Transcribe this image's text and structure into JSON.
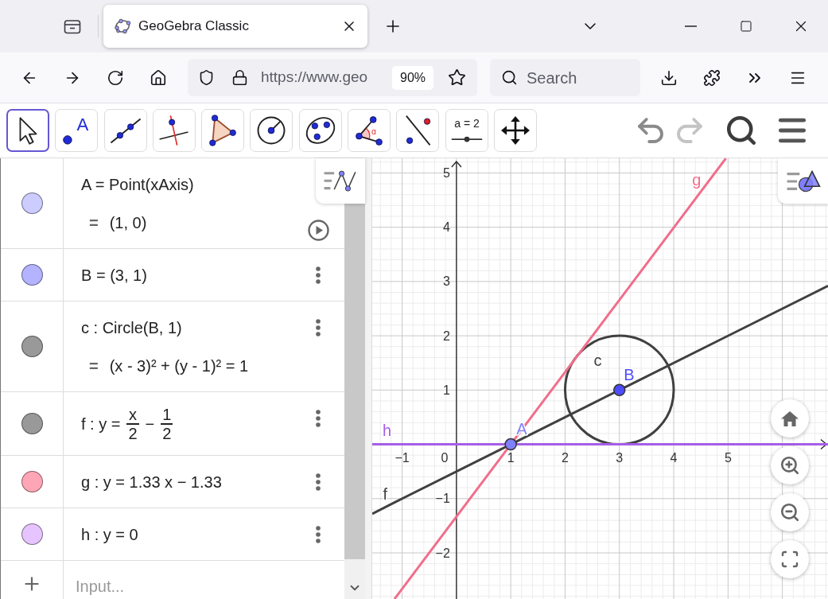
{
  "browser": {
    "tabs": [
      {
        "title": "GeoGebra Classic",
        "selected": true
      }
    ],
    "address": {
      "url": "https://www.geo",
      "zoom": "90%"
    },
    "search": {
      "placeholder": "Search"
    }
  },
  "toolbar": {
    "tools": [
      {
        "kind": "move",
        "selected": true
      },
      {
        "kind": "point",
        "text": "A",
        "selected": false
      },
      {
        "kind": "line",
        "selected": false
      },
      {
        "kind": "perpendicular",
        "selected": false
      },
      {
        "kind": "polygon",
        "selected": false
      },
      {
        "kind": "circle",
        "selected": false
      },
      {
        "kind": "conic",
        "selected": false
      },
      {
        "kind": "angle",
        "text": "α",
        "selected": false
      },
      {
        "kind": "reflect",
        "selected": false
      },
      {
        "kind": "slider",
        "text": "a = 2",
        "selected": false
      },
      {
        "kind": "move_view",
        "selected": false
      }
    ]
  },
  "algebra": {
    "rows": [
      {
        "kind": "animated",
        "color": "#ccccff",
        "definition": [
          {
            "kind": "text",
            "text": "A = Point(xAxis)"
          }
        ],
        "output": {
          "sign": "=",
          "text": "(1, 0)"
        }
      },
      {
        "kind": "static",
        "color": "#b3b3ff",
        "definition": [
          {
            "kind": "text",
            "text": "B = (3, 1)"
          }
        ]
      },
      {
        "kind": "static",
        "color": "#999999",
        "definition": [
          {
            "kind": "text",
            "text": "c : Circle(B, 1)"
          }
        ],
        "output": {
          "sign": "=",
          "text": "(x - 3)² + (y - 1)² = 1"
        }
      },
      {
        "kind": "static",
        "color": "#999999",
        "definition": [
          {
            "kind": "text",
            "text": "f : y ="
          },
          {
            "kind": "fraction",
            "numerator": "x",
            "denominator": "2"
          },
          {
            "kind": "text",
            "text": "−"
          },
          {
            "kind": "fraction",
            "numerator": "1",
            "denominator": "2"
          }
        ]
      },
      {
        "kind": "static",
        "color": "#ffa6b6",
        "definition": [
          {
            "kind": "text",
            "text": "g : y = 1.33 x − 1.33"
          }
        ]
      },
      {
        "kind": "static",
        "color": "#e6c4ff",
        "definition": [
          {
            "kind": "text",
            "text": "h : y = 0"
          }
        ]
      }
    ],
    "input": {
      "placeholder": "Input..."
    }
  },
  "graphics": {
    "origin_label": "0",
    "chart_data": {
      "type": "line",
      "grid": true,
      "x": [
        -1.55,
        -1.14,
        1,
        3,
        4.96,
        6.84
      ],
      "series": [
        {
          "color": "#404040",
          "values": [
            -1.28,
            -1.07,
            0,
            1,
            1.98,
            2.92
          ]
        },
        {
          "color": "#f06e8c",
          "values": [
            null,
            -2.85,
            0,
            2.66,
            5.27,
            null
          ]
        },
        {
          "color": "#a55ee6",
          "values": [
            0,
            0,
            0,
            0,
            0,
            0
          ]
        },
        {
          "color": "#8080ff",
          "marker": "circle",
          "values": [
            null,
            null,
            0,
            null,
            null,
            null
          ]
        },
        {
          "color": "#4d4dff",
          "marker": "circle",
          "values": [
            null,
            null,
            null,
            1,
            null,
            null
          ]
        }
      ],
      "xlim": [
        -1.55,
        6.84
      ],
      "ylim": [
        -2.85,
        5.27
      ],
      "xticks": [
        {
          "value": -1,
          "label": "−1"
        },
        {
          "value": 1,
          "label": "1"
        },
        {
          "value": 2,
          "label": "2"
        },
        {
          "value": 3,
          "label": "3"
        },
        {
          "value": 4,
          "label": "4"
        },
        {
          "value": 5,
          "label": "5"
        }
      ],
      "yticks": [
        {
          "value": -2,
          "label": "−2"
        },
        {
          "value": -1,
          "label": "−1"
        },
        {
          "value": 1,
          "label": "1"
        },
        {
          "value": 2,
          "label": "2"
        },
        {
          "value": 3,
          "label": "3"
        },
        {
          "value": 4,
          "label": "4"
        },
        {
          "value": 5,
          "label": "5"
        }
      ],
      "annotations": [
        "g",
        "c",
        "B",
        "h",
        "A",
        "f"
      ]
    }
  }
}
